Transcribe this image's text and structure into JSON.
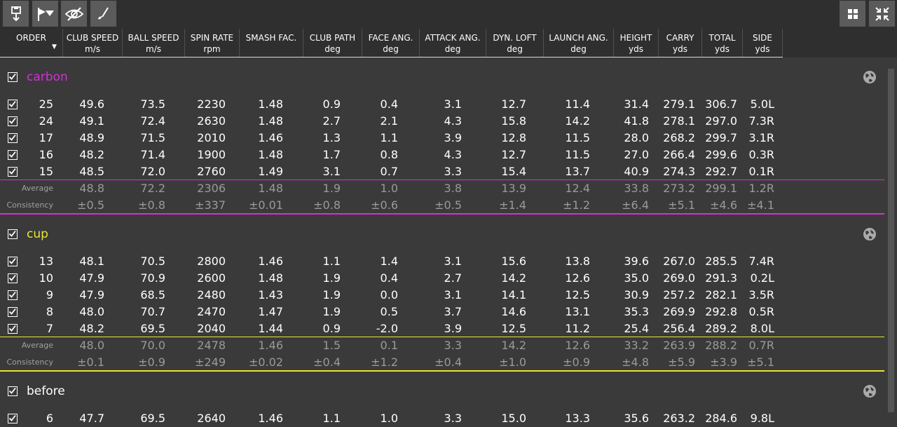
{
  "toolbar": {
    "buttons": [
      {
        "name": "save-export-icon"
      },
      {
        "name": "flag-filter-icon"
      },
      {
        "name": "hide-eye-icon"
      },
      {
        "name": "club-icon"
      }
    ],
    "right_buttons": [
      {
        "name": "grid-view-icon"
      },
      {
        "name": "collapse-icon"
      }
    ]
  },
  "columns": [
    {
      "label": "ORDER",
      "unit": ""
    },
    {
      "label": "CLUB SPEED",
      "unit": "m/s"
    },
    {
      "label": "BALL SPEED",
      "unit": "m/s"
    },
    {
      "label": "SPIN RATE",
      "unit": "rpm"
    },
    {
      "label": "SMASH FAC.",
      "unit": ""
    },
    {
      "label": "CLUB PATH",
      "unit": "deg"
    },
    {
      "label": "FACE ANG.",
      "unit": "deg"
    },
    {
      "label": "ATTACK ANG.",
      "unit": "deg"
    },
    {
      "label": "DYN. LOFT",
      "unit": "deg"
    },
    {
      "label": "LAUNCH ANG.",
      "unit": "deg"
    },
    {
      "label": "HEIGHT",
      "unit": "yds"
    },
    {
      "label": "CARRY",
      "unit": "yds"
    },
    {
      "label": "TOTAL",
      "unit": "yds"
    },
    {
      "label": "SIDE",
      "unit": "yds"
    }
  ],
  "labels": {
    "average": "Average",
    "consistency": "Consistency"
  },
  "groups": [
    {
      "name": "carbon",
      "color": "#d62fd6",
      "checked": true,
      "rows": [
        [
          "25",
          "49.6",
          "73.5",
          "2230",
          "1.48",
          "0.9",
          "0.4",
          "3.1",
          "12.7",
          "11.4",
          "31.4",
          "279.1",
          "306.7",
          "5.0L"
        ],
        [
          "24",
          "49.1",
          "72.4",
          "2630",
          "1.48",
          "2.7",
          "2.1",
          "4.3",
          "15.8",
          "14.2",
          "41.8",
          "278.1",
          "297.0",
          "7.3R"
        ],
        [
          "17",
          "48.9",
          "71.5",
          "2010",
          "1.46",
          "1.3",
          "1.1",
          "3.9",
          "12.8",
          "11.5",
          "28.0",
          "268.2",
          "299.7",
          "3.1R"
        ],
        [
          "16",
          "48.2",
          "71.4",
          "1900",
          "1.48",
          "1.7",
          "0.8",
          "4.3",
          "12.7",
          "11.5",
          "27.0",
          "266.4",
          "299.6",
          "0.3R"
        ],
        [
          "15",
          "48.5",
          "72.0",
          "2760",
          "1.49",
          "3.1",
          "0.7",
          "3.3",
          "15.4",
          "13.7",
          "40.9",
          "274.3",
          "292.7",
          "0.1R"
        ]
      ],
      "average": [
        "48.8",
        "72.2",
        "2306",
        "1.48",
        "1.9",
        "1.0",
        "3.8",
        "13.9",
        "12.4",
        "33.8",
        "273.2",
        "299.1",
        "1.2R"
      ],
      "consistency": [
        "±0.5",
        "±0.8",
        "±337",
        "±0.01",
        "±0.8",
        "±0.6",
        "±0.5",
        "±1.4",
        "±1.2",
        "±6.4",
        "±5.1",
        "±4.6",
        "±4.1"
      ]
    },
    {
      "name": "cup",
      "color": "#e6e632",
      "checked": true,
      "rows": [
        [
          "13",
          "48.1",
          "70.5",
          "2800",
          "1.46",
          "1.1",
          "1.4",
          "3.1",
          "15.6",
          "13.8",
          "39.6",
          "267.0",
          "285.5",
          "7.4R"
        ],
        [
          "10",
          "47.9",
          "70.9",
          "2600",
          "1.48",
          "1.9",
          "0.4",
          "2.7",
          "14.2",
          "12.6",
          "35.0",
          "269.0",
          "291.3",
          "0.2L"
        ],
        [
          "9",
          "47.9",
          "68.5",
          "2480",
          "1.43",
          "1.9",
          "0.0",
          "3.1",
          "14.1",
          "12.5",
          "30.9",
          "257.2",
          "282.1",
          "3.5R"
        ],
        [
          "8",
          "48.0",
          "70.7",
          "2470",
          "1.47",
          "1.9",
          "0.5",
          "3.7",
          "14.6",
          "13.1",
          "35.3",
          "269.9",
          "292.8",
          "0.5R"
        ],
        [
          "7",
          "48.2",
          "69.5",
          "2040",
          "1.44",
          "0.9",
          "-2.0",
          "3.9",
          "12.5",
          "11.2",
          "25.4",
          "256.4",
          "289.2",
          "8.0L"
        ]
      ],
      "average": [
        "48.0",
        "70.0",
        "2478",
        "1.46",
        "1.5",
        "0.1",
        "3.3",
        "14.2",
        "12.6",
        "33.2",
        "263.9",
        "288.2",
        "0.7R"
      ],
      "consistency": [
        "±0.1",
        "±0.9",
        "±249",
        "±0.02",
        "±0.4",
        "±1.2",
        "±0.4",
        "±1.0",
        "±0.9",
        "±4.8",
        "±5.9",
        "±3.9",
        "±5.1"
      ]
    },
    {
      "name": "before",
      "color": "#ffffff",
      "checked": true,
      "rows": [
        [
          "6",
          "47.7",
          "69.5",
          "2640",
          "1.46",
          "1.1",
          "1.0",
          "3.3",
          "15.0",
          "13.3",
          "35.6",
          "263.2",
          "284.6",
          "9.8L"
        ]
      ],
      "average": [],
      "consistency": []
    }
  ]
}
